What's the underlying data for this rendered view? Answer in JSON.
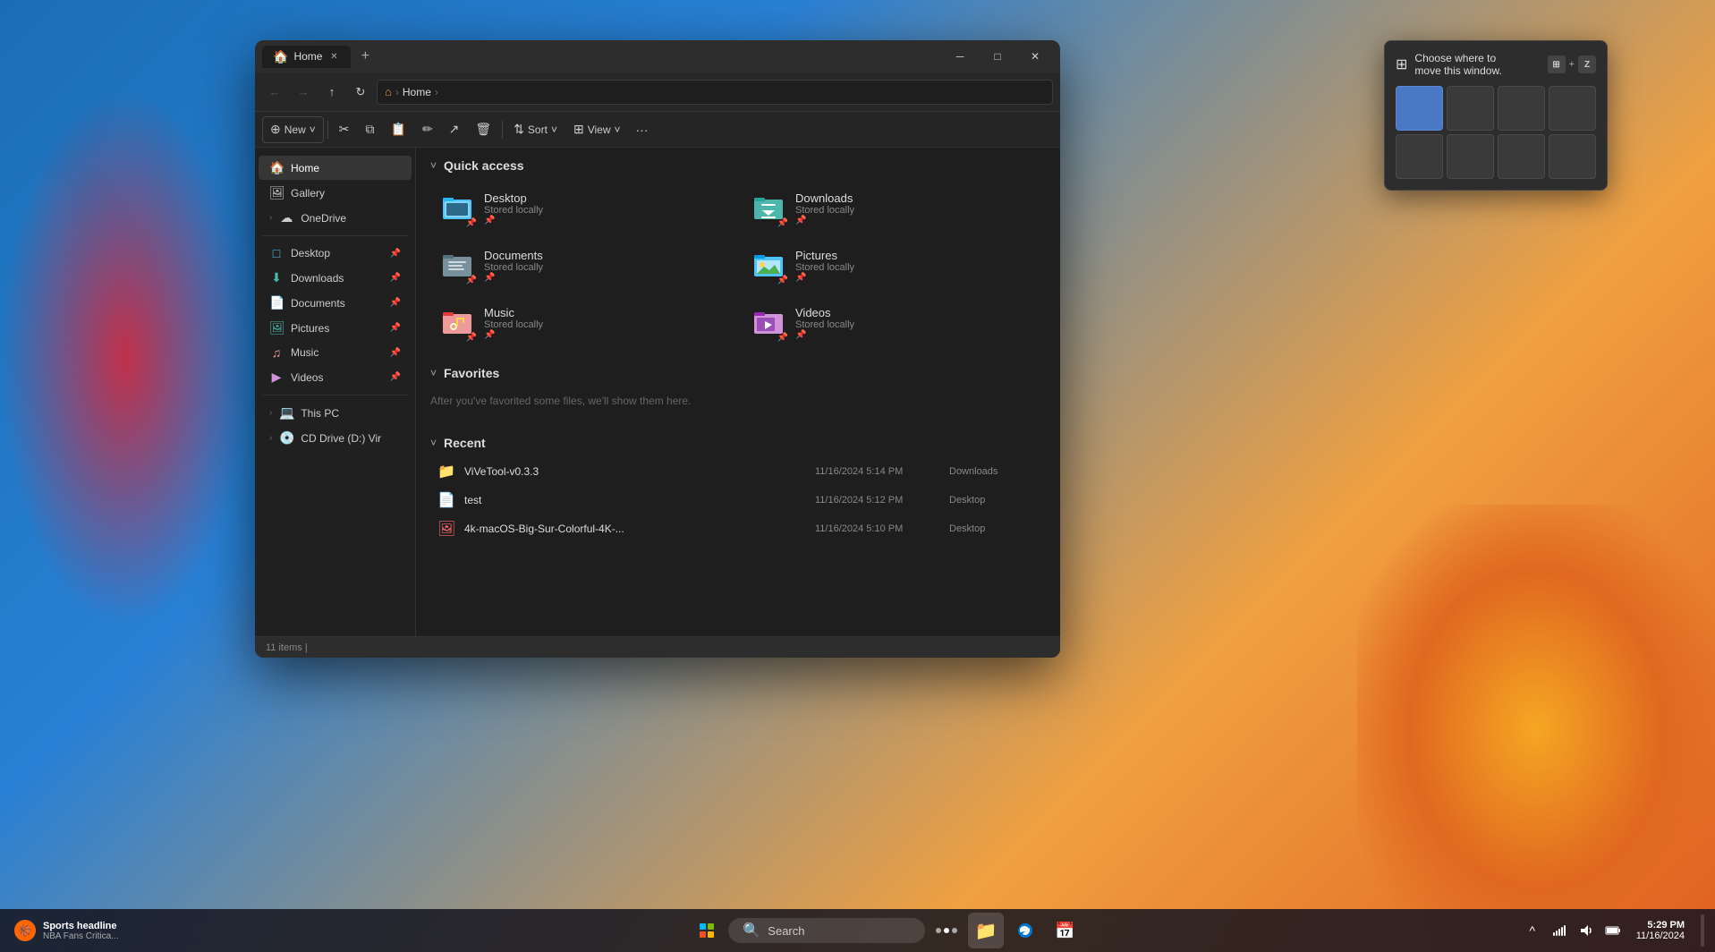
{
  "window": {
    "title": "Home",
    "tab_label": "Home",
    "tab_icon": "🏠"
  },
  "addressbar": {
    "home_icon": "⌂",
    "separator1": ">",
    "location": "Home",
    "separator2": ">"
  },
  "toolbar": {
    "new_label": "New",
    "new_chevron": "˅",
    "cut_icon": "✂",
    "copy_icon": "⧉",
    "paste_icon": "📋",
    "rename_icon": "✏",
    "share_icon": "↗",
    "delete_icon": "🗑",
    "sort_label": "Sort",
    "view_label": "View",
    "more_label": "···"
  },
  "sidebar": {
    "items": [
      {
        "id": "home",
        "icon": "🏠",
        "label": "Home",
        "active": true
      },
      {
        "id": "gallery",
        "icon": "🖼",
        "label": "Gallery",
        "active": false
      },
      {
        "id": "onedrive",
        "icon": "☁",
        "label": "OneDrive",
        "active": false,
        "expandable": true
      }
    ],
    "pinned": [
      {
        "id": "desktop",
        "icon": "🖥",
        "label": "Desktop",
        "color": "blue"
      },
      {
        "id": "downloads",
        "icon": "⬇",
        "label": "Downloads",
        "color": "teal"
      },
      {
        "id": "documents",
        "icon": "📄",
        "label": "Documents",
        "color": "blue"
      },
      {
        "id": "pictures",
        "icon": "🖼",
        "label": "Pictures",
        "color": "teal"
      },
      {
        "id": "music",
        "icon": "♫",
        "label": "Music",
        "color": "orange"
      },
      {
        "id": "videos",
        "icon": "▶",
        "label": "Videos",
        "color": "purple"
      }
    ],
    "system": [
      {
        "id": "thispc",
        "icon": "💻",
        "label": "This PC",
        "expandable": true
      },
      {
        "id": "cddrive",
        "icon": "💿",
        "label": "CD Drive (D:) Vir",
        "expandable": true
      }
    ]
  },
  "quickaccess": {
    "section_label": "Quick access",
    "folders": [
      {
        "id": "desktop",
        "name": "Desktop",
        "status": "Stored locally",
        "icon": "desktop",
        "color": "#4fc3f7"
      },
      {
        "id": "downloads2",
        "name": "Downloads",
        "status": "Stored locally",
        "icon": "downloads",
        "color": "#4db6ac"
      },
      {
        "id": "documents",
        "name": "Documents",
        "status": "Stored locally",
        "icon": "documents",
        "color": "#4fc3f7"
      },
      {
        "id": "pictures",
        "name": "Pictures",
        "status": "Stored locally",
        "icon": "pictures",
        "color": "#29b6f6"
      },
      {
        "id": "music",
        "name": "Music",
        "status": "Stored locally",
        "icon": "music",
        "color": "#ef9a9a"
      },
      {
        "id": "videos",
        "name": "Videos",
        "status": "Stored locally",
        "icon": "videos",
        "color": "#ce93d8"
      }
    ]
  },
  "favorites": {
    "section_label": "Favorites",
    "empty_text": "After you've favorited some files, we'll show them here."
  },
  "recent": {
    "section_label": "Recent",
    "items": [
      {
        "name": "ViVeTool-v0.3.3",
        "date": "11/16/2024 5:14 PM",
        "location": "Downloads",
        "icon": "📁",
        "color": "#ff9800"
      },
      {
        "name": "test",
        "date": "11/16/2024 5:12 PM",
        "location": "Desktop",
        "icon": "📄",
        "color": "#ddd"
      },
      {
        "name": "4k-macOS-Big-Sur-Colorful-4K-...",
        "date": "11/16/2024 5:10 PM",
        "location": "Desktop",
        "icon": "🖼",
        "color": "#ff6b6b"
      }
    ]
  },
  "statusbar": {
    "text": "11 items",
    "cursor": "|"
  },
  "snap_popup": {
    "title": "Choose where to\nmove this window.",
    "icon": "⊞",
    "key1": "⊞",
    "plus": "+",
    "key2": "Z"
  },
  "taskbar": {
    "news_title": "Sports headline",
    "news_sub": "NBA Fans Critica...",
    "search_placeholder": "Search",
    "time": "5:29 PM",
    "date": "11/16/2024"
  }
}
